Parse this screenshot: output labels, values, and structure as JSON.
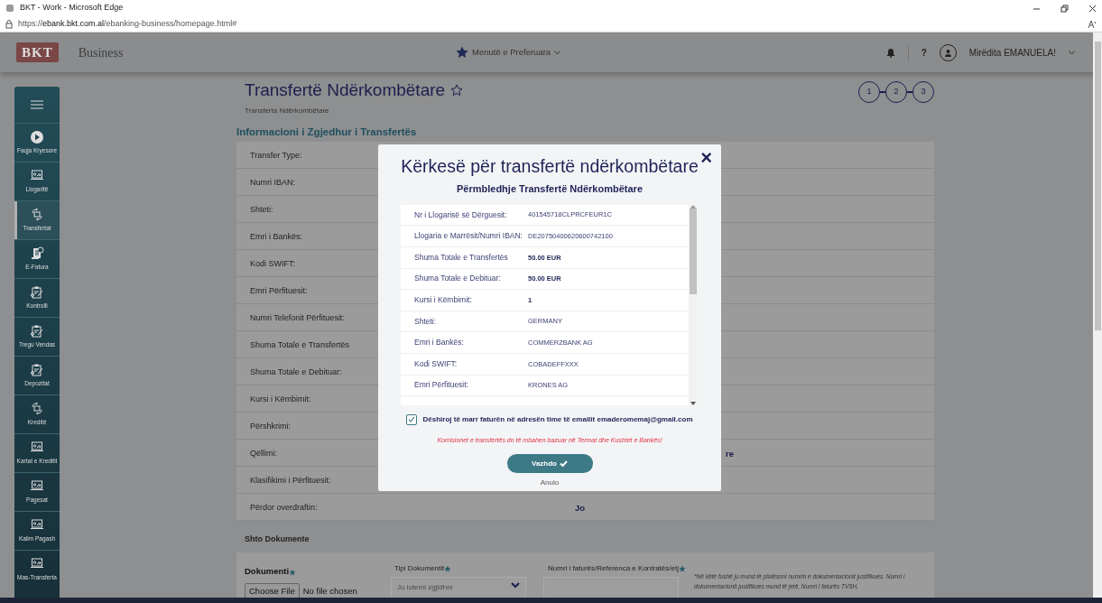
{
  "window": {
    "title": "BKT - Work - Microsoft Edge",
    "url_prefix": "https://",
    "url_host": "ebank.bkt.com.al",
    "url_path": "/ebanking-business/homepage.html#"
  },
  "header": {
    "logo": "BKT",
    "product": "Business",
    "favorites": "Menutë e Preferuara",
    "help": "?",
    "greeting": "Mirëdita EMANUELA!"
  },
  "sidebar": {
    "items": [
      {
        "kind": "home",
        "label": "Faqja Kryesore",
        "selected": false
      },
      {
        "kind": "laptop",
        "label": "Llogaritë",
        "selected": false
      },
      {
        "kind": "exchange",
        "label": "Transfertat",
        "selected": true
      },
      {
        "kind": "invoice",
        "label": "E-Fatura",
        "selected": false
      },
      {
        "kind": "clipboard",
        "label": "Kontrolli",
        "selected": false
      },
      {
        "kind": "clipboard",
        "label": "Tregu Vendas",
        "selected": false
      },
      {
        "kind": "clipboard",
        "label": "Depozitat",
        "selected": false
      },
      {
        "kind": "exchange",
        "label": "Kreditë",
        "selected": false
      },
      {
        "kind": "laptop",
        "label": "Kartat e Kreditit",
        "selected": false
      },
      {
        "kind": "laptop",
        "label": "Pagesat",
        "selected": false
      },
      {
        "kind": "laptop",
        "label": "Kalim Pagash",
        "selected": false
      },
      {
        "kind": "laptop",
        "label": "Mas-Transferta",
        "selected": false
      }
    ]
  },
  "page": {
    "title": "Transfertë Ndërkombëtare",
    "breadcrumb": "Transferta Ndërkombëtare",
    "steps": [
      "1",
      "2",
      "3"
    ],
    "section": "Informacioni i Zgjedhur i Transfertës"
  },
  "details": [
    {
      "label": "Transfer Type:"
    },
    {
      "label": "Numri IBAN:"
    },
    {
      "label": "Shteti:"
    },
    {
      "label": "Emri i Bankës:"
    },
    {
      "label": "Kodi SWIFT:"
    },
    {
      "label": "Emri Përfituesit:"
    },
    {
      "label": "Numri Telefonit Përfituesit:"
    },
    {
      "label": "Shuma Totale e Transfertës"
    },
    {
      "label": "Shuma Totale e Debituar:"
    },
    {
      "label": "Kursi i Këmbimit:"
    },
    {
      "label": "Përshkrimi:"
    },
    {
      "label": "Qëllimi:",
      "value_tail": "re"
    },
    {
      "label": "Klasifikimi i Përfituesit:"
    },
    {
      "label": "Përdor overdraftin:",
      "value": "Jo"
    }
  ],
  "documents": {
    "title": "Shto Dokumente",
    "document_label": "Dokumenti",
    "choose_file": "Choose File",
    "no_file": "No file chosen",
    "type_label": "Tipi Dokumentit",
    "type_placeholder": "Ju lutemi zgjidhni",
    "number_label": "Numri i faturës/Referenca e Kontratës/etj",
    "note": "*Në këtë fushë ju mund të plotësoni numrin e dokumentacionit justifikues. Numri i dokumentacionit justifikues mund të jetë, Numri i faturës TVSH,"
  },
  "modal": {
    "title": "Kërkesë për transfertë ndërkombëtare",
    "close": "×",
    "subtitle": "Përmbledhje Transfertë Ndërkombëtare",
    "rows": [
      {
        "label": "Nr i Llogarisë së Dërguesit:",
        "value": "401545718CLPRCFEUR1C",
        "strong": false
      },
      {
        "label": "Llogaria e Marrësit/Numri IBAN:",
        "value": "DE20750400620600742100",
        "strong": false
      },
      {
        "label": "Shuma Totale e Transfertës",
        "value": "50.00 EUR",
        "strong": true
      },
      {
        "label": "Shuma Totale e Debituar:",
        "value": "50.00 EUR",
        "strong": true
      },
      {
        "label": "Kursi i Këmbimit:",
        "value": "1",
        "strong": true
      },
      {
        "label": "Shteti:",
        "value": "GERMANY",
        "strong": false
      },
      {
        "label": "Emri i Bankës:",
        "value": "COMMERZBANK AG",
        "strong": false
      },
      {
        "label": "Kodi SWIFT:",
        "value": "COBADEFFXXX",
        "strong": false
      },
      {
        "label": "Emri Përfituesit:",
        "value": "KRONES AG",
        "strong": false
      }
    ],
    "consent": {
      "text": "Dëshiroj të marr faturën në adresën time të emailit emaderomemaj@gmail.com",
      "checked": true
    },
    "fee_note": "Komisionet e transfertës do të mbahen bazuar në Termat dhe Kushtet e Bankës!",
    "continue": "Vazhdo",
    "cancel": "Anulo"
  }
}
